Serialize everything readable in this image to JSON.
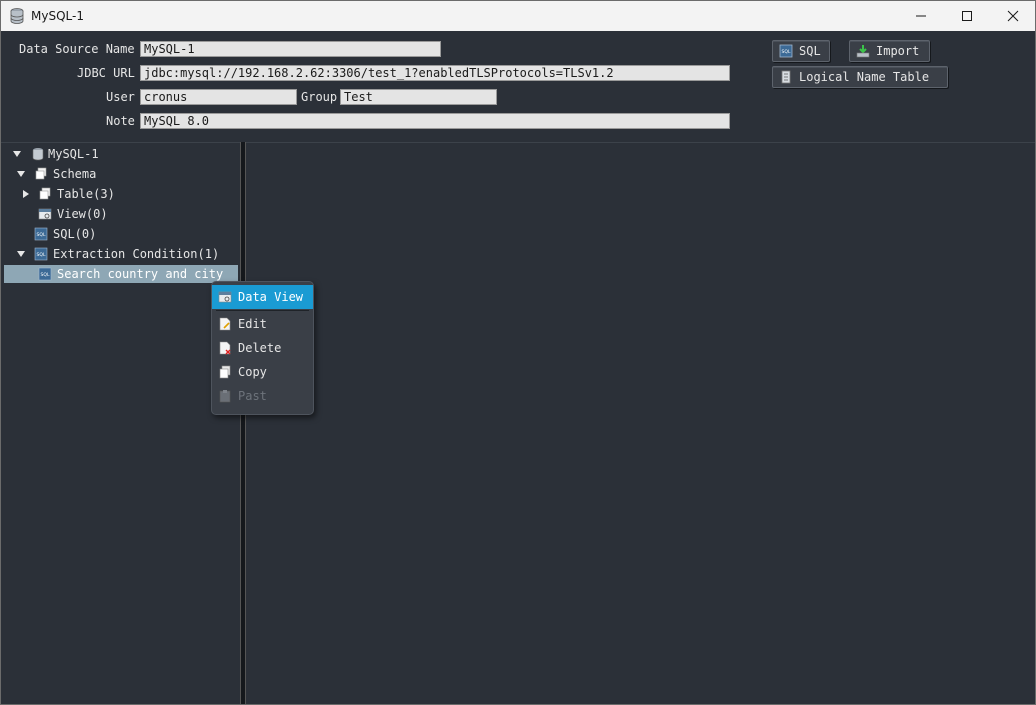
{
  "window": {
    "title": "MySQL-1"
  },
  "form": {
    "data_source_name_label": "Data Source Name",
    "data_source_name": "MySQL-1",
    "jdbc_url_label": "JDBC URL",
    "jdbc_url": "jdbc:mysql://192.168.2.62:3306/test_1?enabledTLSProtocols=TLSv1.2",
    "user_label": "User",
    "user": "cronus",
    "group_label": "Group",
    "group": "Test",
    "note_label": "Note",
    "note": "MySQL 8.0"
  },
  "toolbar": {
    "sql_label": "SQL",
    "import_label": "Import",
    "logical_name_table_label": "Logical Name Table"
  },
  "tree": {
    "root": "MySQL-1",
    "schema": "Schema",
    "table": "Table(3)",
    "view": "View(0)",
    "sql": "SQL(0)",
    "extraction_condition": "Extraction Condition(1)",
    "search_item": "Search country and city"
  },
  "context_menu": {
    "items": [
      {
        "label": "Data View",
        "state": "active"
      },
      {
        "label": "Edit",
        "state": "enabled"
      },
      {
        "label": "Delete",
        "state": "enabled"
      },
      {
        "label": "Copy",
        "state": "enabled"
      },
      {
        "label": "Past",
        "state": "disabled"
      }
    ]
  },
  "colors": {
    "panel_bg": "#2b3038",
    "selected_row": "#8ea7b5",
    "menu_highlight": "#1a9bd3"
  }
}
